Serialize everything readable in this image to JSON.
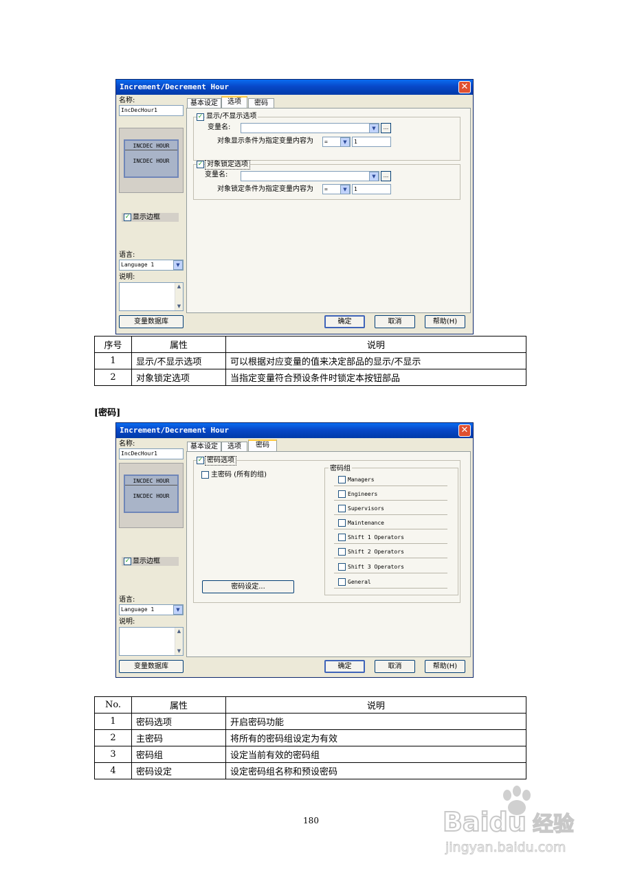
{
  "dialog1": {
    "title": "Increment/Decrement Hour",
    "name_label": "名称:",
    "name_value": "IncDecHour1",
    "preview_caption": "INCDEC HOUR",
    "preview_text": "INCDEC HOUR",
    "show_border_label": "显示边框",
    "language_label": "语言:",
    "language_value": "Language 1",
    "notes_label": "说明:",
    "var_db_button": "变量数据库",
    "tabs": [
      "基本设定",
      "选项",
      "密码"
    ],
    "group1_label": "显示/不显示选项",
    "var_name_label_1": "变量名:",
    "condition_label_1": "对象显示条件为指定变量内容为",
    "op_1": "=",
    "value_1": "1",
    "group2_label": "对象锁定选项",
    "var_name_label_2": "变量名:",
    "condition_label_2": "对象锁定条件为指定变量内容为",
    "op_2": "=",
    "value_2": "1",
    "browse": "...",
    "ok": "确定",
    "cancel": "取消",
    "help": "帮助(H)"
  },
  "table1": {
    "headers": [
      "序号",
      "属性",
      "说明"
    ],
    "rows": [
      [
        "1",
        "显示/不显示选项",
        "可以根据对应变量的值来决定部品的显示/不显示"
      ],
      [
        "2",
        "对象锁定选项",
        "当指定变量符合预设条件时锁定本按钮部品"
      ]
    ]
  },
  "section_heading": "[密码]",
  "dialog2": {
    "title": "Increment/Decrement Hour",
    "name_label": "名称:",
    "name_value": "IncDecHour1",
    "preview_caption": "INCDEC HOUR",
    "preview_text": "INCDEC HOUR",
    "show_border_label": "显示边框",
    "language_label": "语言:",
    "language_value": "Language 1",
    "notes_label": "说明:",
    "var_db_button": "变量数据库",
    "tabs": [
      "基本设定",
      "选项",
      "密码"
    ],
    "password_option": "密码选项",
    "master_password": "主密码 (所有的组)",
    "password_group_label": "密码组",
    "groups": [
      "Managers",
      "Engineers",
      "Supervisors",
      "Maintenance",
      "Shift 1 Operators",
      "Shift 2 Operators",
      "Shift 3 Operators",
      "General"
    ],
    "password_setup_button": "密码设定...",
    "ok": "确定",
    "cancel": "取消",
    "help": "帮助(H)"
  },
  "table2": {
    "headers": [
      "No.",
      "属性",
      "说明"
    ],
    "rows": [
      [
        "1",
        "密码选项",
        "开启密码功能"
      ],
      [
        "2",
        "主密码",
        "将所有的密码组设定为有效"
      ],
      [
        "3",
        "密码组",
        "设定当前有效的密码组"
      ],
      [
        "4",
        "密码设定",
        "设定密码组名称和预设密码"
      ]
    ]
  },
  "page_number": "180",
  "watermark": {
    "brand": "Baidu",
    "suffix": "经验",
    "url": "jingyan.baidu.com"
  }
}
